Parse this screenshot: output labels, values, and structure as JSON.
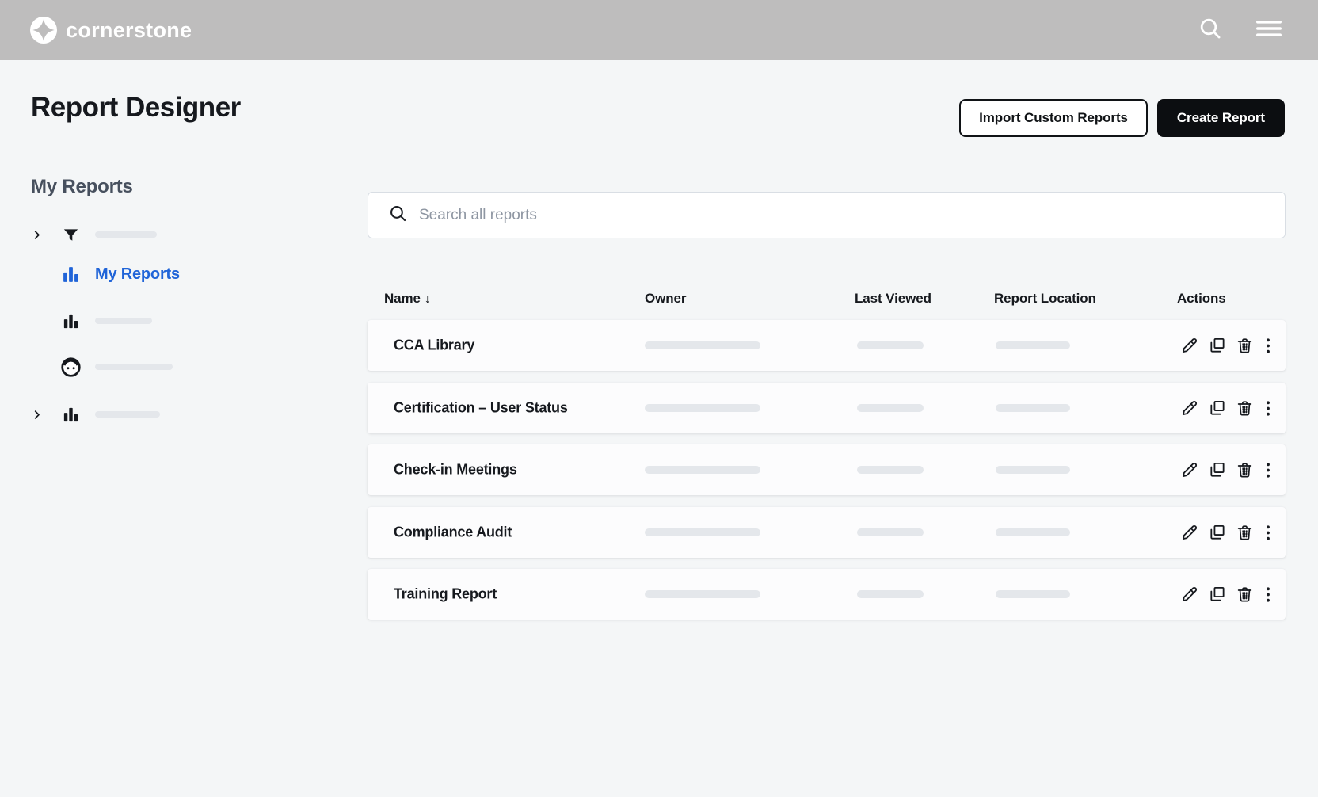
{
  "topbar": {
    "brand": "cornerstone",
    "icons": {
      "logo": "sparkle-in-circle",
      "search": "magnifier",
      "menu": "hamburger"
    }
  },
  "page": {
    "title": "Report Designer"
  },
  "header_actions": {
    "import_label": "Import Custom Reports",
    "create_label": "Create Report"
  },
  "sidebar": {
    "heading": "My Reports",
    "items": [
      {
        "icon": "filter-funnel",
        "expandable": true,
        "label": ""
      },
      {
        "icon": "bar-chart",
        "expandable": false,
        "label": "My Reports",
        "active": true
      },
      {
        "icon": "bar-chart",
        "expandable": false,
        "label": ""
      },
      {
        "icon": "person-face",
        "expandable": false,
        "label": ""
      },
      {
        "icon": "bar-chart",
        "expandable": true,
        "label": ""
      }
    ],
    "active_label": "My Reports"
  },
  "search": {
    "placeholder": "Search all reports",
    "value": ""
  },
  "table": {
    "columns": [
      "Name",
      "Owner",
      "Last Viewed",
      "Report Location",
      "Actions"
    ],
    "sort_indicator": "↓",
    "sort": {
      "column": "Name",
      "direction": "descending"
    },
    "rows": [
      {
        "name": "CCA Library"
      },
      {
        "name": "Certification – User Status"
      },
      {
        "name": "Check-in Meetings"
      },
      {
        "name": "Compliance Audit"
      },
      {
        "name": "Training Report"
      }
    ],
    "row_actions": [
      "edit",
      "copy",
      "delete",
      "more"
    ]
  },
  "colors": {
    "topbar_gray": "#bebdbd",
    "accent_blue": "#2064d8",
    "button_black": "#0c0e11",
    "text_dark": "#16191e",
    "skeleton_gray": "#e4e7eb",
    "background": "#f4f6f7"
  }
}
